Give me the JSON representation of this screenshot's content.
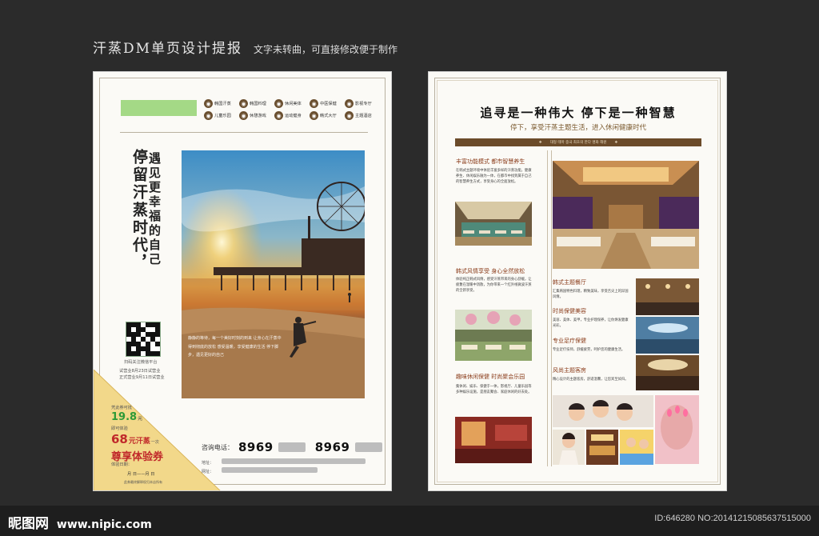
{
  "header": {
    "title": "汗蒸DM单页设计提报",
    "subtitle": "文字未转曲，可直接修改便于制作"
  },
  "left_page": {
    "icons": [
      {
        "icon": "spa-icon",
        "label": "韩国汗蒸"
      },
      {
        "icon": "spa-icon",
        "label": "韩国料理"
      },
      {
        "icon": "spa-icon",
        "label": "休闲美体"
      },
      {
        "icon": "spa-icon",
        "label": "中医保健"
      },
      {
        "icon": "spa-icon",
        "label": "影视专厅"
      },
      {
        "icon": "spa-icon",
        "label": "儿童乐园"
      },
      {
        "icon": "spa-icon",
        "label": "休憩游戏"
      },
      {
        "icon": "spa-icon",
        "label": "运动健身"
      },
      {
        "icon": "spa-icon",
        "label": "韩式大厅"
      },
      {
        "icon": "spa-icon",
        "label": "主题酒店"
      }
    ],
    "slogan_line1": "停留汗蒸时代，",
    "slogan_line2": "遇见更幸福的自己",
    "photo_overlay": "静静的等待，每一个美好时刻的到来 让身心在汗蒸中得到彻底的放松 感受温暖，享受健康的生活 停下脚步，遇见更好的自己",
    "qr_caption": "扫码关注微信平台",
    "open_dates": [
      "试营业8月23日试营业",
      "正式营业9月11日试营业"
    ],
    "coupon": {
      "label1": "凭此券可抵",
      "price1": "19.8",
      "unit1": "元",
      "label2": "即可体验",
      "price2": "68",
      "unit2": "元汗蒸",
      "suffix2": "一次",
      "cta": "尊享体验券",
      "date_label": "体验日期：",
      "date_line": "月 日——月 日",
      "fine_print": "此券最终解释权归本店所有"
    },
    "contact_label": "咨询电话：",
    "phone1": "8969",
    "phone2": "8969",
    "address_label": "地址：",
    "website_label": "网址："
  },
  "right_page": {
    "headline": "追寻是一种伟大  停下是一种智慧",
    "subline": "停下，享受汗蒸主题生活，进入休闲健康时代",
    "band_text": "대형 테마 중국 최초의 한다 명화 해원",
    "s1_title": "丰富功能模式  都市智慧养生",
    "s1_body": "在韩式主题环境中体验丰富多样的汗蒸功能，健康养生、休闲娱乐融为一体，在都市中找到属于自己的智慧养生方式，享受身心的全面放松。",
    "s2_title": "韩式风情享受  身心全然放松",
    "s2_body": "体验纯正韩式风情，感受汗蒸带来的身心舒缓，让疲惫在温暖中消散，为你带来一个红外线微波汗蒸的全新享受。",
    "s3_title": "韩式主题餐厅",
    "s3_body": "汇集韩国特色料理，精致美味，享受舌尖上的异国风情。",
    "s4_title": "时尚保健美容",
    "s4_body": "美容、美体、美甲，专业护理保养，让你焕发健康光彩。",
    "s5_title": "专业足疗保健",
    "s5_body": "专业足疗技师，舒缓疲劳，呵护您的健康生活。",
    "s6_title": "风尚主题客房",
    "s6_body": "精心设计的主题客房，舒适温馨，让您宾至如归。",
    "s7_title": "趣味休闲保健  时尚聚会乐园",
    "s7_body": "集休闲、娱乐、保健于一体，影视厅、儿童乐园等多种娱乐设施，是朋友聚会、家庭休闲的好去处。"
  },
  "footer": {
    "logo": "昵图网",
    "url": "www.nipic.com",
    "image_id": "ID:646280 NO:20141215085637515000"
  }
}
